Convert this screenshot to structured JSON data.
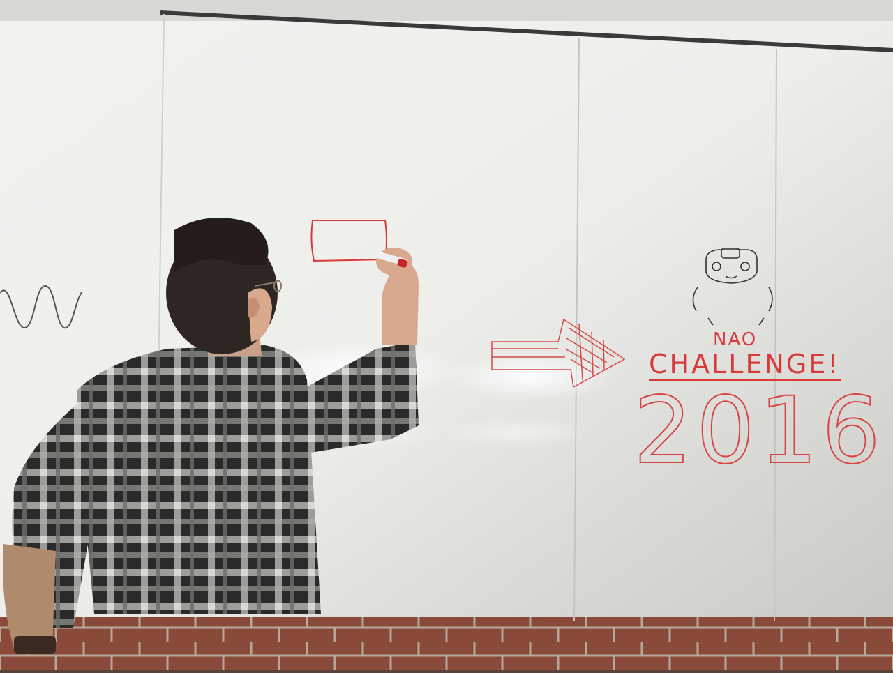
{
  "scene": {
    "description_tags": [
      "whiteboard",
      "person-writing",
      "robot-sketch"
    ],
    "colors": {
      "board": "#e9e9e6",
      "board_shadow": "#b8b9b8",
      "marker_red": "#d83a3a",
      "marker_black": "#333333",
      "brick_wall": "#8a4a3a",
      "shirt_dark": "#2a2a2a",
      "shirt_light": "#b0b0ad",
      "hair": "#2e2622",
      "skin": "#d9a98e"
    }
  },
  "whiteboard": {
    "drawings": {
      "nao_text": "NAO",
      "challenge_text": "CHALLENGE!",
      "year_text": "2016"
    },
    "icons": [
      "robot-head-icon",
      "arrow-sketch-icon",
      "rectangle-sketch-icon",
      "wave-sketch-icon"
    ]
  },
  "person": {
    "holding": "marker-icon"
  }
}
